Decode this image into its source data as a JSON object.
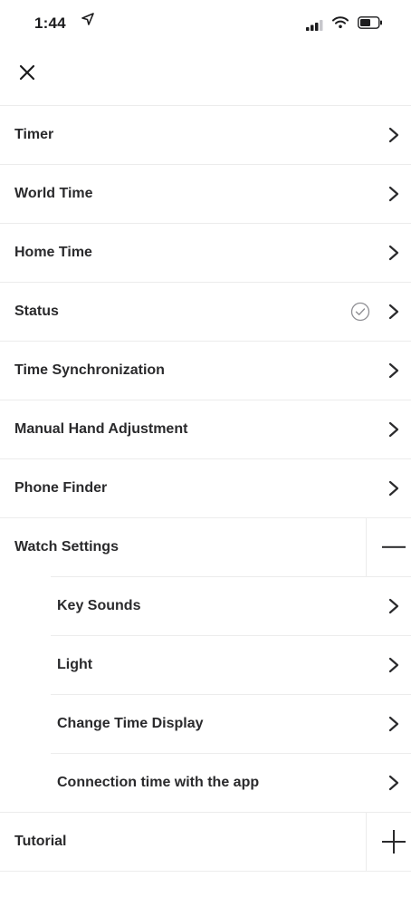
{
  "status_bar": {
    "time": "1:44",
    "location_icon": "location-arrow-icon",
    "signal_icon": "cellular-signal-icon",
    "wifi_icon": "wifi-icon",
    "battery_icon": "battery-icon"
  },
  "header": {
    "close_icon": "close-icon"
  },
  "menu": {
    "items": [
      {
        "label": "Timer",
        "control": "chevron-right-icon"
      },
      {
        "label": "World Time",
        "control": "chevron-right-icon"
      },
      {
        "label": "Home Time",
        "control": "chevron-right-icon"
      },
      {
        "label": "Status",
        "control": "chevron-right-icon",
        "status_icon": "check-circle-icon"
      },
      {
        "label": "Time Synchronization",
        "control": "chevron-right-icon"
      },
      {
        "label": "Manual Hand Adjustment",
        "control": "chevron-right-icon"
      },
      {
        "label": "Phone Finder",
        "control": "chevron-right-icon"
      },
      {
        "label": "Watch Settings",
        "control": "collapse-minus-icon",
        "expanded": true,
        "children": [
          {
            "label": "Key Sounds",
            "control": "chevron-right-icon"
          },
          {
            "label": "Light",
            "control": "chevron-right-icon"
          },
          {
            "label": "Change Time Display",
            "control": "chevron-right-icon"
          },
          {
            "label": "Connection time with the app",
            "control": "chevron-right-icon"
          }
        ]
      },
      {
        "label": "Tutorial",
        "control": "expand-plus-icon",
        "expanded": false
      }
    ]
  }
}
